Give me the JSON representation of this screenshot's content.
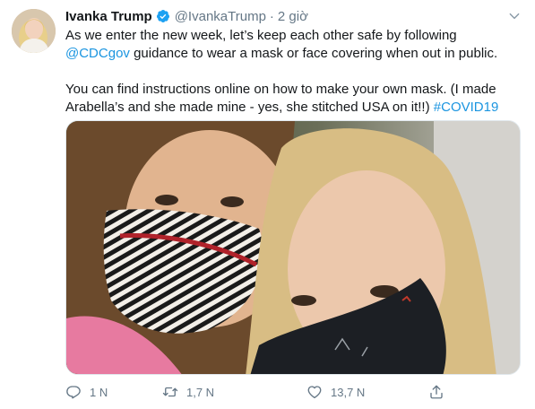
{
  "tweet": {
    "author_name": "Ivanka Trump",
    "handle": "@IvankaTrump",
    "separator": "·",
    "time": "2 giờ",
    "paragraph1_pre": "As we enter the new week, let’s keep each other safe by following ",
    "mention": "@CDCgov",
    "paragraph1_post": " guidance to wear a mask or face covering when out in public.",
    "paragraph2_pre": "You can find instructions online on how to make your own mask. (I made Arabella’s and she made mine - yes, she stitched USA on it!!) ",
    "hashtag": "#COVID19"
  },
  "actions": {
    "reply_count": "1 N",
    "retweet_count": "1,7 N",
    "like_count": "13,7 N"
  },
  "icons": {
    "verified": "verified-badge-icon",
    "more": "chevron-down-icon",
    "reply": "reply-icon",
    "retweet": "retweet-icon",
    "like": "heart-icon",
    "share": "share-icon"
  },
  "colors": {
    "link": "#1b95e0",
    "muted": "#657786",
    "text": "#14171a"
  }
}
